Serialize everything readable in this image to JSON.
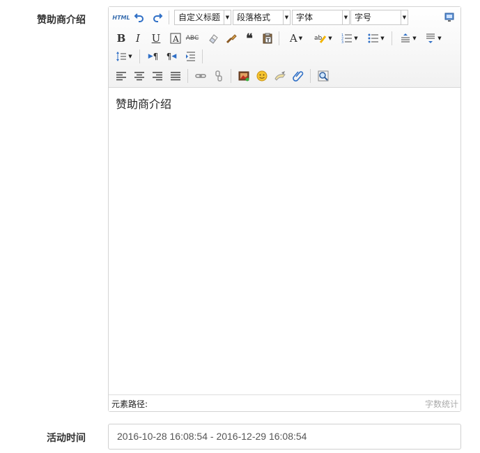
{
  "form": {
    "sponsor_label": "赞助商介绍",
    "time_label": "活动时间",
    "time_value": "2016-10-28 16:08:54 - 2016-12-29 16:08:54"
  },
  "editor": {
    "dropdowns": {
      "custom_title": "自定义标题",
      "paragraph": "段落格式",
      "font": "字体",
      "size": "字号"
    },
    "content_text": "赞助商介绍",
    "element_path_label": "元素路径:",
    "word_count_label": "字数统计"
  },
  "icons": {
    "html": "HTML"
  }
}
